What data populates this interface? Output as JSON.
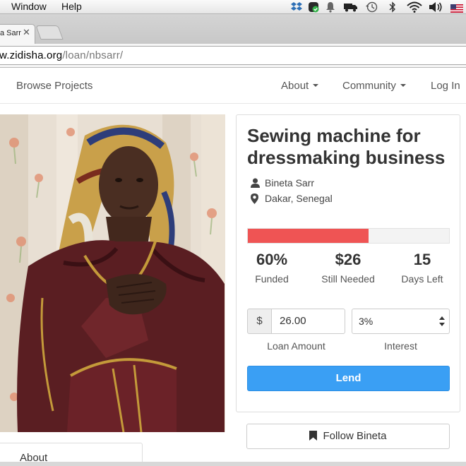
{
  "menubar": {
    "items": [
      "Window",
      "Help"
    ],
    "tray_icons": [
      "dropbox-icon",
      "shield-check-icon",
      "bell-icon",
      "truck-icon",
      "time-machine-icon",
      "bluetooth-icon",
      "wifi-icon",
      "volume-icon",
      "us-flag-icon"
    ]
  },
  "browser": {
    "tab_title": "a Sarr",
    "url_host": "w.zidisha.org",
    "url_path": "/loan/nbsarr/"
  },
  "nav": {
    "browse": "Browse Projects",
    "about": "About",
    "community": "Community",
    "login": "Log In"
  },
  "loan": {
    "title": "Sewing machine for dressmaking business",
    "borrower": "Bineta Sarr",
    "location": "Dakar, Senegal",
    "funded_fraction": 0.6,
    "stats": [
      {
        "value": "60%",
        "label": "Funded"
      },
      {
        "value": "$26",
        "label": "Still Needed"
      },
      {
        "value": "15",
        "label": "Days Left"
      }
    ],
    "currency_symbol": "$",
    "amount_value": "26.00",
    "amount_label": "Loan Amount",
    "interest_value": "3%",
    "interest_label": "Interest",
    "lend_label": "Lend",
    "follow_label": "Follow Bineta",
    "about_tab": "About"
  },
  "colors": {
    "progress_fill": "#ef5454",
    "lend_button": "#3a9ff4"
  }
}
